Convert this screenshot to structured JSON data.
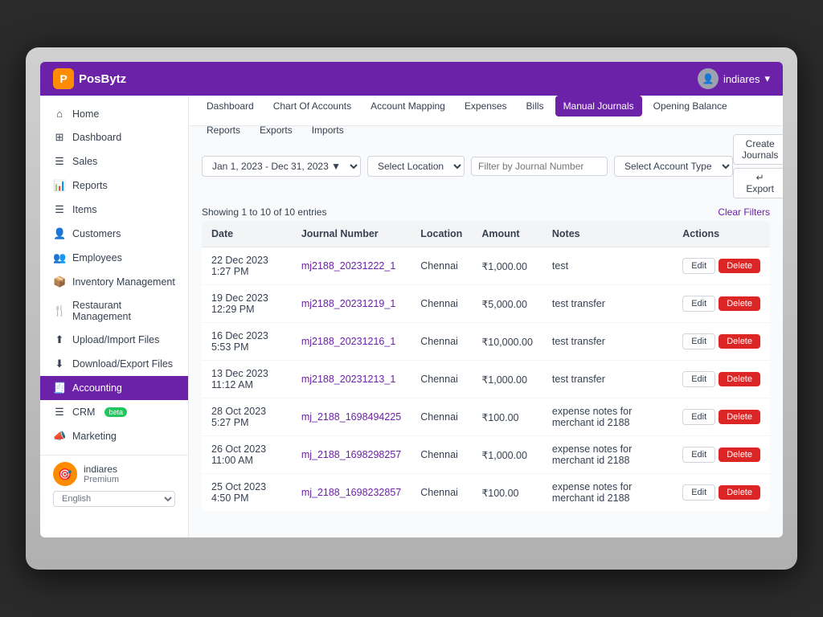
{
  "app": {
    "name": "PosBytz",
    "logo_initial": "P",
    "user": "indiares",
    "user_chevron": "▾"
  },
  "sidebar": {
    "items": [
      {
        "id": "home",
        "icon": "⌂",
        "label": "Home"
      },
      {
        "id": "dashboard",
        "icon": "⊞",
        "label": "Dashboard"
      },
      {
        "id": "sales",
        "icon": "☰",
        "label": "Sales"
      },
      {
        "id": "reports",
        "icon": "📊",
        "label": "Reports"
      },
      {
        "id": "items",
        "icon": "☰",
        "label": "Items"
      },
      {
        "id": "customers",
        "icon": "👤",
        "label": "Customers"
      },
      {
        "id": "employees",
        "icon": "👥",
        "label": "Employees"
      },
      {
        "id": "inventory",
        "icon": "📦",
        "label": "Inventory Management"
      },
      {
        "id": "restaurant",
        "icon": "🍴",
        "label": "Restaurant Management"
      },
      {
        "id": "upload",
        "icon": "⬆",
        "label": "Upload/Import Files"
      },
      {
        "id": "download",
        "icon": "⬇",
        "label": "Download/Export Files"
      },
      {
        "id": "accounting",
        "icon": "🧾",
        "label": "Accounting",
        "active": true
      },
      {
        "id": "crm",
        "icon": "☰",
        "label": "CRM",
        "badge": "beta"
      },
      {
        "id": "marketing",
        "icon": "📣",
        "label": "Marketing"
      }
    ],
    "user_name": "indiares",
    "user_plan": "Premium",
    "lang_options": [
      "English"
    ],
    "lang_selected": "English"
  },
  "subnav": {
    "items": [
      {
        "id": "dashboard",
        "label": "Dashboard"
      },
      {
        "id": "chart-of-accounts",
        "label": "Chart Of Accounts"
      },
      {
        "id": "account-mapping",
        "label": "Account Mapping"
      },
      {
        "id": "expenses",
        "label": "Expenses"
      },
      {
        "id": "bills",
        "label": "Bills"
      },
      {
        "id": "manual-journals",
        "label": "Manual Journals",
        "active": true
      },
      {
        "id": "opening-balance",
        "label": "Opening Balance"
      },
      {
        "id": "reports",
        "label": "Reports"
      },
      {
        "id": "exports",
        "label": "Exports"
      },
      {
        "id": "imports",
        "label": "Imports"
      }
    ]
  },
  "toolbar": {
    "date_range": "Jan 1, 2023 - Dec 31, 2023 ▼",
    "location_placeholder": "Select Location",
    "journal_number_placeholder": "Filter by Journal Number",
    "account_type_placeholder": "Select Account Type",
    "create_button": "Create Journals",
    "export_button": "↵ Export",
    "clear_filters": "Clear Filters",
    "showing_text": "Showing 1 to 10 of 10 entries"
  },
  "table": {
    "headers": [
      "Date",
      "Journal Number",
      "Location",
      "Amount",
      "Notes",
      "Actions"
    ],
    "rows": [
      {
        "date": "22 Dec 2023 1:27 PM",
        "journal_number": "mj2188_20231222_1",
        "location": "Chennai",
        "amount": "₹1,000.00",
        "notes": "test"
      },
      {
        "date": "19 Dec 2023 12:29 PM",
        "journal_number": "mj2188_20231219_1",
        "location": "Chennai",
        "amount": "₹5,000.00",
        "notes": "test transfer"
      },
      {
        "date": "16 Dec 2023 5:53 PM",
        "journal_number": "mj2188_20231216_1",
        "location": "Chennai",
        "amount": "₹10,000.00",
        "notes": "test transfer"
      },
      {
        "date": "13 Dec 2023 11:12 AM",
        "journal_number": "mj2188_20231213_1",
        "location": "Chennai",
        "amount": "₹1,000.00",
        "notes": "test transfer"
      },
      {
        "date": "28 Oct 2023 5:27 PM",
        "journal_number": "mj_2188_1698494225",
        "location": "Chennai",
        "amount": "₹100.00",
        "notes": "expense notes for merchant id 2188"
      },
      {
        "date": "26 Oct 2023 11:00 AM",
        "journal_number": "mj_2188_1698298257",
        "location": "Chennai",
        "amount": "₹1,000.00",
        "notes": "expense notes for merchant id 2188"
      },
      {
        "date": "25 Oct 2023 4:50 PM",
        "journal_number": "mj_2188_1698232857",
        "location": "Chennai",
        "amount": "₹100.00",
        "notes": "expense notes for merchant id 2188"
      }
    ],
    "edit_label": "Edit",
    "delete_label": "Delete"
  }
}
